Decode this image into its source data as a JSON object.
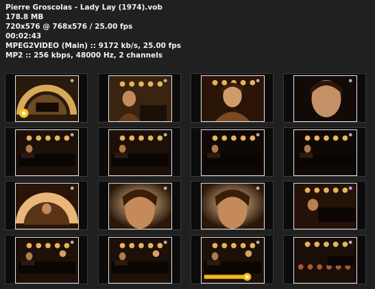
{
  "header": {
    "lines": [
      "Pierre Groscolas - Lady Lay (1974).vob",
      "178.8 MB",
      "720x576 @ 768x576 / 25.00 fps",
      "00:02:43",
      "MPEG2VIDEO (Main) :: 9172 kb/s, 25.00 fps",
      "MP2 :: 256 kbps, 48000 Hz, 2 channels"
    ]
  },
  "thumbnails": [
    {
      "scene": "stage-arc",
      "overlay": "logo-circle"
    },
    {
      "scene": "face-wide"
    },
    {
      "scene": "face-mid"
    },
    {
      "scene": "face-close"
    },
    {
      "scene": "piano-wide"
    },
    {
      "scene": "piano-wide"
    },
    {
      "scene": "piano-dark"
    },
    {
      "scene": "piano-dark"
    },
    {
      "scene": "piano-arc"
    },
    {
      "scene": "face-tight"
    },
    {
      "scene": "face-tight"
    },
    {
      "scene": "piano-close"
    },
    {
      "scene": "piano-wide2"
    },
    {
      "scene": "piano-wide2"
    },
    {
      "scene": "piano-wide2",
      "overlay": "progress-bar"
    },
    {
      "scene": "audience"
    }
  ],
  "colors": {
    "background": "#202020",
    "text": "#f2f2f2",
    "thumb_border": "#e8e8e8",
    "accent": "#e8b817"
  }
}
